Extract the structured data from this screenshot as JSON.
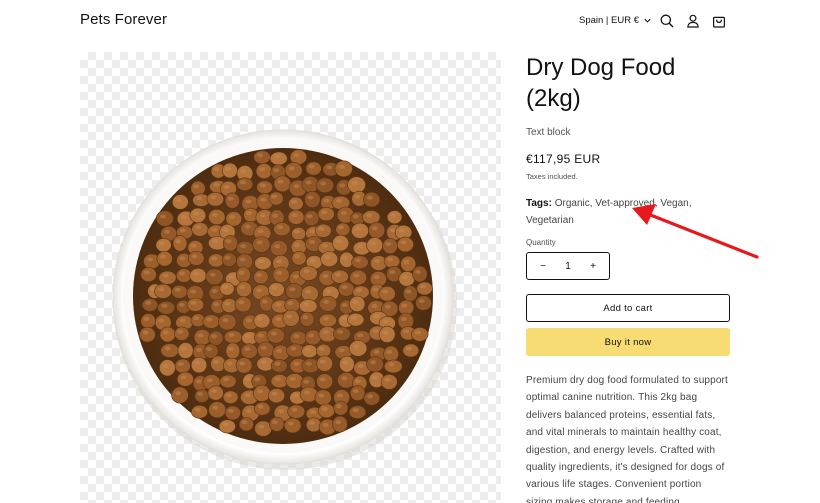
{
  "header": {
    "store_name": "Pets Forever",
    "locale_label": "Spain | EUR €",
    "icons": [
      "chevron-down-icon",
      "search-icon",
      "account-icon",
      "cart-icon"
    ]
  },
  "product": {
    "title": "Dry Dog Food (2kg)",
    "text_block": "Text block",
    "price": "€117,95 EUR",
    "taxes_note": "Taxes included.",
    "tags_label": "Tags:",
    "tags_value": " Organic, Vet-approved, Vegan, Vegetarian",
    "quantity_label": "Quantity",
    "quantity_value": "1",
    "quantity_minus": "−",
    "quantity_plus": "+",
    "add_to_cart_label": "Add to cart",
    "buy_now_label": "Buy it now",
    "description": "Premium dry dog food formulated to support optimal canine nutrition. This 2kg bag delivers balanced proteins, essential fats, and vital minerals to maintain healthy coat, digestion, and energy levels. Crafted with quality ingredients, it's designed for dogs of various life stages. Convenient portion sizing makes storage and feeding"
  },
  "colors": {
    "buy_now_bg": "#f7dc74",
    "annotation_arrow": "#e8191c",
    "text": "#121212"
  }
}
